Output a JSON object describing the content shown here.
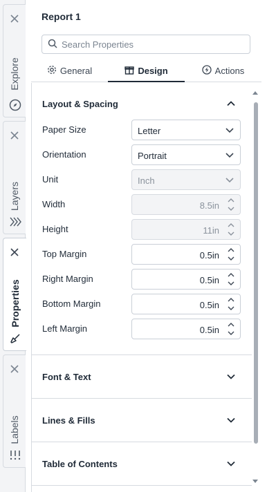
{
  "rail": {
    "tabs": [
      {
        "label": "Explore",
        "icon": "compass-icon"
      },
      {
        "label": "Layers",
        "icon": "layers-icon"
      },
      {
        "label": "Properties",
        "icon": "paint-brush-icon",
        "active": true
      },
      {
        "label": "Labels",
        "icon": "labels-icon"
      }
    ]
  },
  "panel": {
    "title": "Report 1",
    "search": {
      "placeholder": "Search Properties",
      "value": ""
    },
    "tabs": [
      {
        "label": "General",
        "icon": "gear-icon"
      },
      {
        "label": "Design",
        "icon": "gift-icon",
        "active": true
      },
      {
        "label": "Actions",
        "icon": "bolt-icon"
      }
    ]
  },
  "sections": {
    "layout": {
      "title": "Layout & Spacing",
      "expanded": true,
      "props": {
        "paper_size": {
          "label": "Paper Size",
          "value": "Letter"
        },
        "orientation": {
          "label": "Orientation",
          "value": "Portrait"
        },
        "unit": {
          "label": "Unit",
          "value": "Inch",
          "disabled": true
        },
        "width": {
          "label": "Width",
          "value": "8.5in",
          "disabled": true
        },
        "height": {
          "label": "Height",
          "value": "11in",
          "disabled": true
        },
        "top_margin": {
          "label": "Top Margin",
          "value": "0.5in"
        },
        "right_margin": {
          "label": "Right Margin",
          "value": "0.5in"
        },
        "bottom_margin": {
          "label": "Bottom Margin",
          "value": "0.5in"
        },
        "left_margin": {
          "label": "Left Margin",
          "value": "0.5in"
        }
      }
    },
    "font": {
      "title": "Font & Text",
      "expanded": false
    },
    "lines": {
      "title": "Lines & Fills",
      "expanded": false
    },
    "toc": {
      "title": "Table of Contents",
      "expanded": false
    }
  },
  "colors": {
    "text": "#1f2a37",
    "border": "#c9cfd7",
    "disabled_bg": "#f3f4f6",
    "scroll_thumb": "#a8aeb6"
  }
}
